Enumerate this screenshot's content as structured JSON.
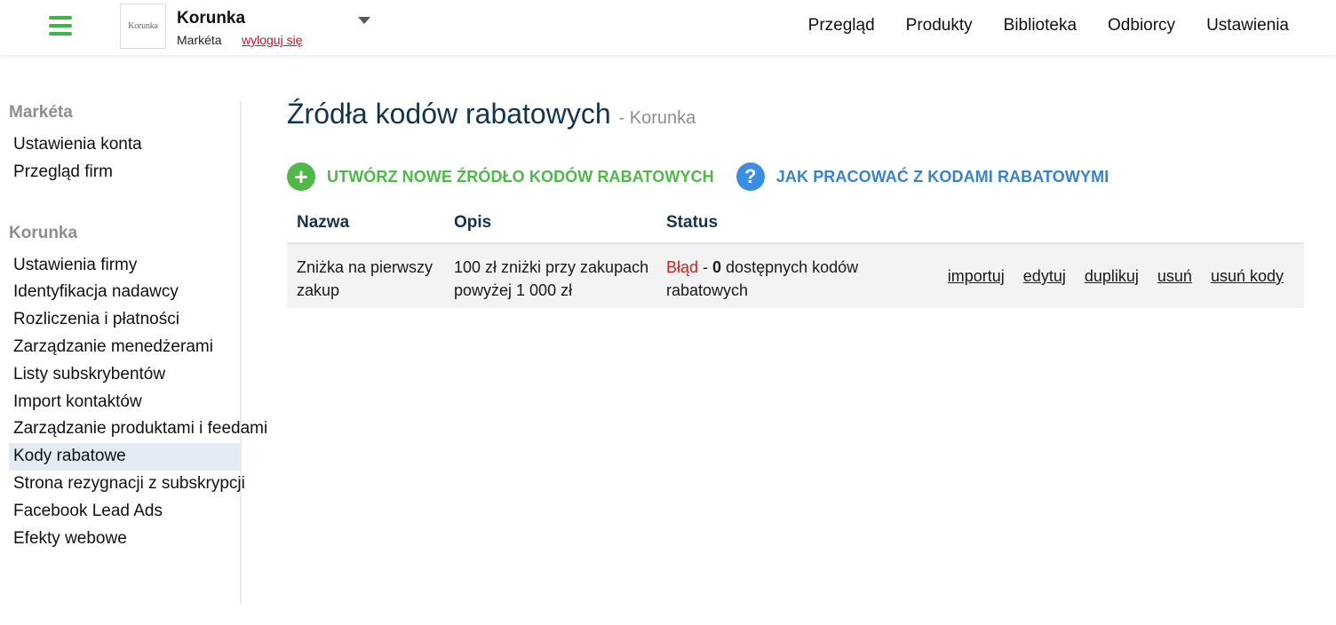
{
  "header": {
    "logo_text": "Korunka",
    "company_name": "Korunka",
    "user_name": "Markéta",
    "logout_label": "wyloguj się",
    "nav": [
      "Przegląd",
      "Produkty",
      "Biblioteka",
      "Odbiorcy",
      "Ustawienia"
    ]
  },
  "sidebar": {
    "groups": [
      {
        "title": "Markéta",
        "items": [
          "Ustawienia konta",
          "Przegląd firm"
        ]
      },
      {
        "title": "Korunka",
        "items": [
          "Ustawienia firmy",
          "Identyfikacja nadawcy",
          "Rozliczenia i płatności",
          "Zarządzanie menedżerami",
          "Listy subskrybentów",
          "Import kontaktów",
          "Zarządzanie produktami i feedami",
          "Kody rabatowe",
          "Strona rezygnacji z subskrypcji",
          "Facebook Lead Ads",
          "Efekty webowe"
        ]
      }
    ],
    "active_item": "Kody rabatowe"
  },
  "main": {
    "title": "Źródła kodów rabatowych",
    "subtitle": "- Korunka",
    "create_label": "UTWÓRZ NOWE ŹRÓDŁO KODÓW RABATOWYCH",
    "help_label": "JAK PRACOWAĆ Z KODAMI RABATOWYMI",
    "table": {
      "headers": [
        "Nazwa",
        "Opis",
        "Status"
      ],
      "rows": [
        {
          "name_line1": "Zniżka na pierwszy",
          "name_line2": "zakup",
          "desc_line1": "100 zł zniżki przy zakupach",
          "desc_line2": "powyżej 1 000 zł",
          "status_label": "Błąd",
          "status_sep": " - ",
          "status_count": "0",
          "status_text": " dostępnych kodów",
          "status_line2": "rabatowych",
          "actions": [
            "importuj",
            "edytuj",
            "duplikuj",
            "usuń",
            "usuń kody"
          ]
        }
      ]
    }
  },
  "colors": {
    "accent_green": "#4fb849",
    "accent_blue": "#3a8de0",
    "error_red": "#d0211b",
    "title_navy": "#12344d"
  }
}
